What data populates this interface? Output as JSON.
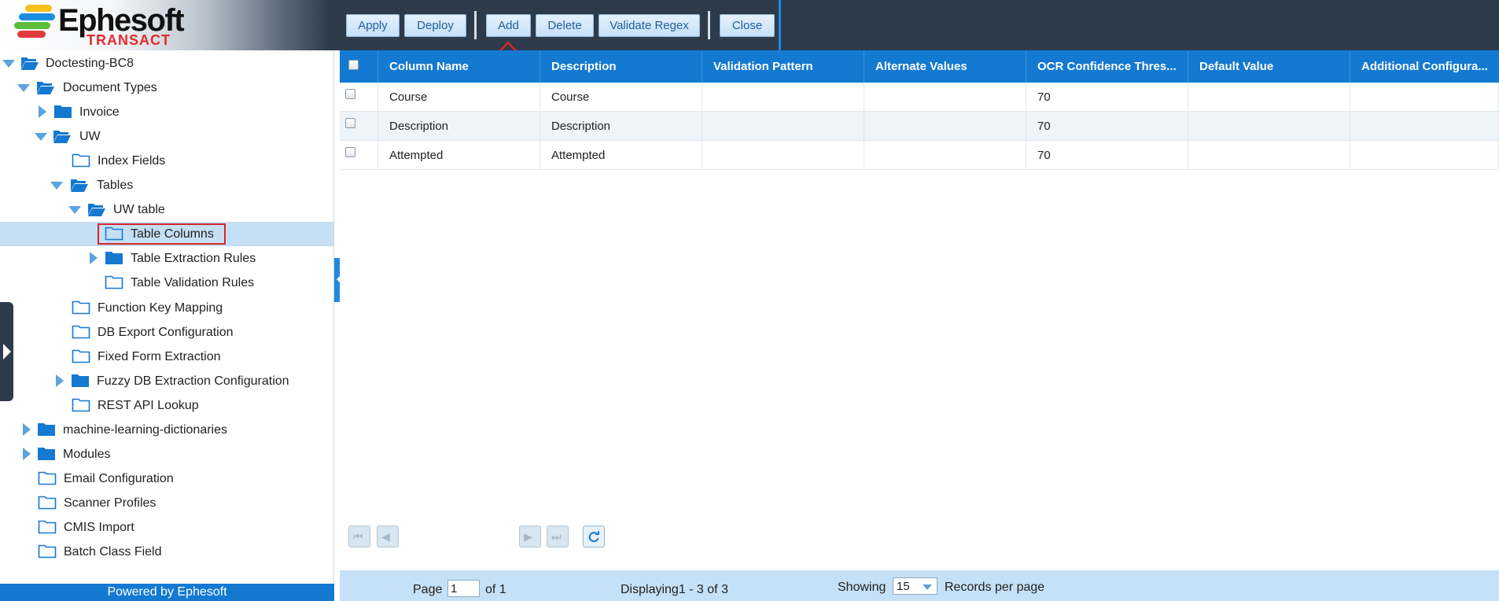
{
  "logo": {
    "word": "Ephesoft",
    "sub": "TRANSACT"
  },
  "toolbar": {
    "apply": "Apply",
    "deploy": "Deploy",
    "add": "Add",
    "delete": "Delete",
    "validate_regex": "Validate Regex",
    "close": "Close"
  },
  "tree": {
    "root": "Doctesting-BC8",
    "document_types": "Document Types",
    "invoice": "Invoice",
    "uw": "UW",
    "index_fields": "Index Fields",
    "tables": "Tables",
    "uw_table": "UW table",
    "table_columns": "Table Columns",
    "table_extraction_rules": "Table Extraction Rules",
    "table_validation_rules": "Table Validation Rules",
    "function_key_mapping": "Function Key Mapping",
    "db_export_configuration": "DB Export Configuration",
    "fixed_form_extraction": "Fixed Form Extraction",
    "fuzzy_db_extraction_configuration": "Fuzzy DB Extraction Configuration",
    "rest_api_lookup": "REST API Lookup",
    "machine_learning_dictionaries": "machine-learning-dictionaries",
    "modules": "Modules",
    "email_configuration": "Email Configuration",
    "scanner_profiles": "Scanner Profiles",
    "cmis_import": "CMIS Import",
    "batch_class_field": "Batch Class Field"
  },
  "footer": {
    "powered_by": "Powered by Ephesoft"
  },
  "grid": {
    "columns": [
      "Column Name",
      "Description",
      "Validation Pattern",
      "Alternate Values",
      "OCR Confidence Thres...",
      "Default Value",
      "Additional Configura..."
    ],
    "rows": [
      [
        "Course",
        "Course",
        "",
        "",
        "70",
        "",
        ""
      ],
      [
        "Description",
        "Description",
        "",
        "",
        "70",
        "",
        ""
      ],
      [
        "Attempted",
        "Attempted",
        "",
        "",
        "70",
        "",
        ""
      ]
    ]
  },
  "pager": {
    "page_label": "Page",
    "page_value": "1",
    "of_label": "of 1",
    "displaying": "Displaying1 - 3 of 3",
    "showing_label": "Showing",
    "page_size": "15",
    "records_label": "Records per page"
  },
  "colors": {
    "header_bg": "#2d3a4a",
    "accent_blue": "#1479d1",
    "selected_row": "#c5dff4",
    "highlight_red": "#d9262c",
    "folder_blue": "#1479d1"
  },
  "icons": {
    "folder_open": "folder-open-icon",
    "folder_closed": "folder-closed-icon",
    "folder_outline": "folder-outline-icon",
    "expand": "chevron-right-icon",
    "collapse": "chevron-down-icon"
  }
}
